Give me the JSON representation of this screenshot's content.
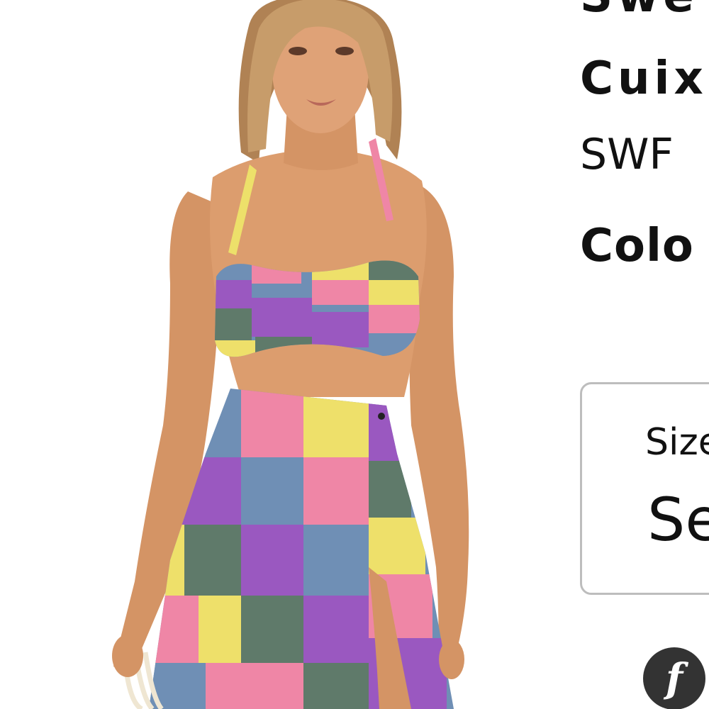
{
  "product": {
    "title_line1": "Swe",
    "title_line2": "Cuix",
    "sku": "SWF",
    "color_label": "Colo"
  },
  "size_selector": {
    "label": "Size",
    "value": "Se"
  },
  "brand_badge": {
    "glyph": "f"
  },
  "colors": {
    "patch_pink": "#ef86a6",
    "patch_yellow": "#eee06a",
    "patch_blue": "#6f8fb5",
    "patch_purple": "#9a58c0",
    "patch_green": "#5f7a6a",
    "skin": "#d99a6c",
    "hair": "#b8895a"
  }
}
